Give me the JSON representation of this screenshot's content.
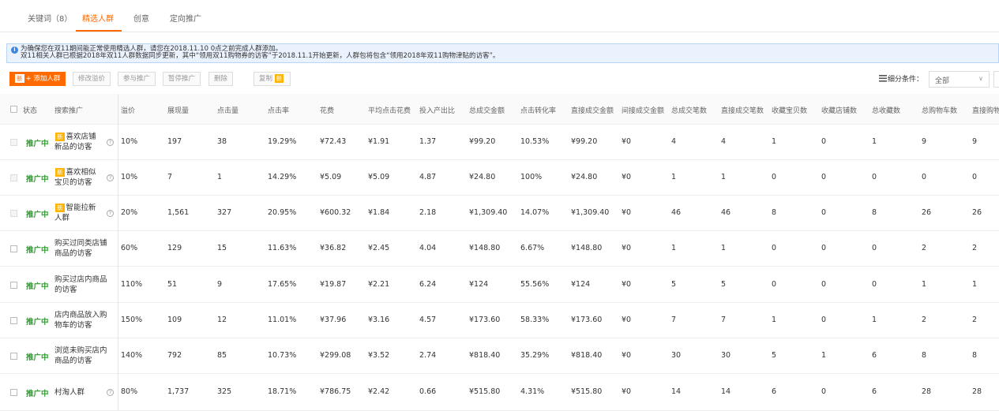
{
  "tabs": [
    {
      "label": "关键词（8）"
    },
    {
      "label": "精选人群",
      "active": true
    },
    {
      "label": "创意"
    },
    {
      "label": "定向推广"
    }
  ],
  "notice": {
    "line1": "为确保您在双11期间能正常使用精选人群，请您在2018.11.10 0点之前完成人群添加。",
    "line2": "双11相关人群已根据2018年双11人群数据同步更新，其中“领用双11购物券的访客”于2018.11.1开始更新，人群包将包含“领用2018年双11购物津贴的访客”。"
  },
  "toolbar": {
    "new_tag": "新",
    "add": "+ 添加人群",
    "modify_bid": "修改溢价",
    "join": "参与推广",
    "pause": "暂停推广",
    "delete": "删除",
    "copy": "复制"
  },
  "filter": {
    "label": "细分条件：",
    "value": "全部"
  },
  "columns": [
    "状态",
    "搜索推广",
    "溢价",
    "展现量",
    "点击量",
    "点击率",
    "花费",
    "平均点击花费",
    "投入产出比",
    "总成交金额",
    "点击转化率",
    "直接成交金额",
    "间接成交金额",
    "总成交笔数",
    "直接成交笔数",
    "收藏宝贝数",
    "收藏店铺数",
    "总收藏数",
    "总购物车数",
    "直接购物"
  ],
  "colors": {
    "accent": "#ff6a00",
    "status": "#2e9c2e",
    "notice_bg": "#e9f2fd"
  },
  "rows": [
    {
      "status": "推广中",
      "new": true,
      "name_a": "喜欢店铺",
      "name_b": "新品的访客",
      "help": "?",
      "bid": "10%",
      "impr": "197",
      "clicks": "38",
      "ctr": "19.29%",
      "cost": "¥72.43",
      "cpc": "¥1.91",
      "roi": "1.37",
      "gmv": "¥99.20",
      "cvr": "10.53%",
      "direct": "¥99.20",
      "indirect": "¥0",
      "orders": "4",
      "direct_orders": "4",
      "fav_items": "1",
      "fav_shops": "0",
      "fav_total": "1",
      "carts": "9",
      "direct_carts": "9"
    },
    {
      "status": "推广中",
      "new": true,
      "name_a": "喜欢相似",
      "name_b": "宝贝的访客",
      "help": "?",
      "bid": "10%",
      "impr": "7",
      "clicks": "1",
      "ctr": "14.29%",
      "cost": "¥5.09",
      "cpc": "¥5.09",
      "roi": "4.87",
      "gmv": "¥24.80",
      "cvr": "100%",
      "direct": "¥24.80",
      "indirect": "¥0",
      "orders": "1",
      "direct_orders": "1",
      "fav_items": "0",
      "fav_shops": "0",
      "fav_total": "0",
      "carts": "0",
      "direct_carts": "0"
    },
    {
      "status": "推广中",
      "new": true,
      "name_a": "智能拉新",
      "name_b": "人群",
      "help": "?",
      "bid": "20%",
      "impr": "1,561",
      "clicks": "327",
      "ctr": "20.95%",
      "cost": "¥600.32",
      "cpc": "¥1.84",
      "roi": "2.18",
      "gmv": "¥1,309.40",
      "cvr": "14.07%",
      "direct": "¥1,309.40",
      "indirect": "¥0",
      "orders": "46",
      "direct_orders": "46",
      "fav_items": "8",
      "fav_shops": "0",
      "fav_total": "8",
      "carts": "26",
      "direct_carts": "26"
    },
    {
      "status": "推广中",
      "new": false,
      "name_a": "购买过同类店铺",
      "name_b": "商品的访客",
      "help": "",
      "bid": "60%",
      "impr": "129",
      "clicks": "15",
      "ctr": "11.63%",
      "cost": "¥36.82",
      "cpc": "¥2.45",
      "roi": "4.04",
      "gmv": "¥148.80",
      "cvr": "6.67%",
      "direct": "¥148.80",
      "indirect": "¥0",
      "orders": "1",
      "direct_orders": "1",
      "fav_items": "0",
      "fav_shops": "0",
      "fav_total": "0",
      "carts": "2",
      "direct_carts": "2"
    },
    {
      "status": "推广中",
      "new": false,
      "name_a": "购买过店内商品",
      "name_b": "的访客",
      "help": "",
      "bid": "110%",
      "impr": "51",
      "clicks": "9",
      "ctr": "17.65%",
      "cost": "¥19.87",
      "cpc": "¥2.21",
      "roi": "6.24",
      "gmv": "¥124",
      "cvr": "55.56%",
      "direct": "¥124",
      "indirect": "¥0",
      "orders": "5",
      "direct_orders": "5",
      "fav_items": "0",
      "fav_shops": "0",
      "fav_total": "0",
      "carts": "1",
      "direct_carts": "1"
    },
    {
      "status": "推广中",
      "new": false,
      "name_a": "店内商品放入购",
      "name_b": "物车的访客",
      "help": "",
      "bid": "150%",
      "impr": "109",
      "clicks": "12",
      "ctr": "11.01%",
      "cost": "¥37.96",
      "cpc": "¥3.16",
      "roi": "4.57",
      "gmv": "¥173.60",
      "cvr": "58.33%",
      "direct": "¥173.60",
      "indirect": "¥0",
      "orders": "7",
      "direct_orders": "7",
      "fav_items": "1",
      "fav_shops": "0",
      "fav_total": "1",
      "carts": "2",
      "direct_carts": "2"
    },
    {
      "status": "推广中",
      "new": false,
      "name_a": "浏览未购买店内",
      "name_b": "商品的访客",
      "help": "",
      "bid": "140%",
      "impr": "792",
      "clicks": "85",
      "ctr": "10.73%",
      "cost": "¥299.08",
      "cpc": "¥3.52",
      "roi": "2.74",
      "gmv": "¥818.40",
      "cvr": "35.29%",
      "direct": "¥818.40",
      "indirect": "¥0",
      "orders": "30",
      "direct_orders": "30",
      "fav_items": "5",
      "fav_shops": "1",
      "fav_total": "6",
      "carts": "8",
      "direct_carts": "8"
    },
    {
      "status": "推广中",
      "new": false,
      "name_a": "",
      "name_b": "村淘人群",
      "help": "?",
      "bid": "80%",
      "impr": "1,737",
      "clicks": "325",
      "ctr": "18.71%",
      "cost": "¥786.75",
      "cpc": "¥2.42",
      "roi": "0.66",
      "gmv": "¥515.80",
      "cvr": "4.31%",
      "direct": "¥515.80",
      "indirect": "¥0",
      "orders": "14",
      "direct_orders": "14",
      "fav_items": "6",
      "fav_shops": "0",
      "fav_total": "6",
      "carts": "28",
      "direct_carts": "28"
    }
  ]
}
